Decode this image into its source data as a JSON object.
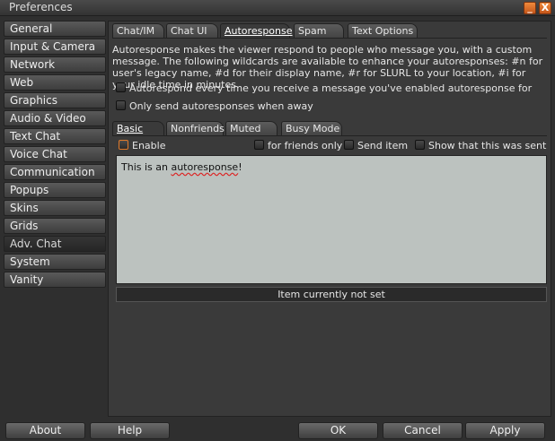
{
  "window": {
    "title": "Preferences",
    "minimize": "_",
    "close": "X"
  },
  "sidebar": {
    "items": [
      {
        "label": "General"
      },
      {
        "label": "Input & Camera"
      },
      {
        "label": "Network"
      },
      {
        "label": "Web"
      },
      {
        "label": "Graphics"
      },
      {
        "label": "Audio & Video"
      },
      {
        "label": "Text Chat"
      },
      {
        "label": "Voice Chat"
      },
      {
        "label": "Communication"
      },
      {
        "label": "Popups"
      },
      {
        "label": "Skins"
      },
      {
        "label": "Grids"
      },
      {
        "label": "Adv. Chat"
      },
      {
        "label": "System"
      },
      {
        "label": "Vanity"
      }
    ],
    "active_index": 12
  },
  "tabs": [
    {
      "label": "Chat/IM"
    },
    {
      "label": "Chat UI"
    },
    {
      "label": "Autoresponse"
    },
    {
      "label": "Spam"
    },
    {
      "label": "Text Options"
    }
  ],
  "description": "Autoresponse makes the viewer respond to people who message you, with a custom message. The following wildcards are available to enhance your autoresponses: #n for user's legacy name, #d for their display name, #r for SLURL to your location, #i for your idle time in minutes.",
  "options": {
    "autorespond_every_time": "Autorespond every time you receive a message you've enabled autoresponse for",
    "only_when_away": "Only send autoresponses when away"
  },
  "subtabs": [
    {
      "label": "Basic"
    },
    {
      "label": "Nonfriends"
    },
    {
      "label": "Muted"
    },
    {
      "label": "Busy Mode"
    }
  ],
  "basic": {
    "enable": "Enable",
    "friends_only": "for friends only",
    "send_item": "Send item",
    "show_sent": "Show that this was sent",
    "message_prefix": "This is an ",
    "message_misspelled": "autoresponse",
    "message_suffix": "!",
    "item_status": "Item currently not set"
  },
  "footer": {
    "about": "About",
    "help": "Help",
    "ok": "OK",
    "cancel": "Cancel",
    "apply": "Apply"
  }
}
